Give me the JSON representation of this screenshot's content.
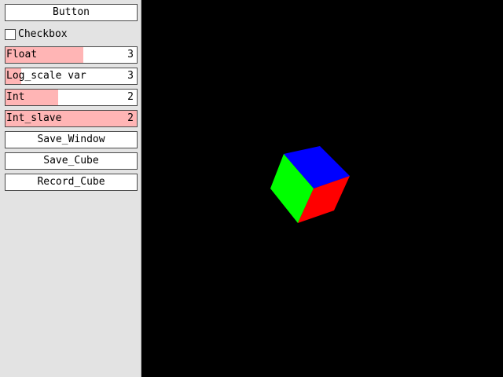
{
  "panel": {
    "button_label": "Button",
    "checkbox": {
      "label": "Checkbox",
      "checked": false
    },
    "sliders": [
      {
        "label": "Float",
        "value": "3",
        "fill_fraction": 0.59
      },
      {
        "label": "Log_scale var",
        "value": "3",
        "fill_fraction": 0.12
      },
      {
        "label": "Int",
        "value": "2",
        "fill_fraction": 0.4
      },
      {
        "label": "Int_slave",
        "value": "2",
        "fill_fraction": 1.0
      }
    ],
    "save_window_label": "Save_Window",
    "save_cube_label": "Save_Cube",
    "record_cube_label": "Record_Cube"
  },
  "colors": {
    "panel_bg": "#e3e3e3",
    "slider_fill": "#ffb5b5",
    "viewport_bg": "#000000",
    "cube_top": "#0000ff",
    "cube_left": "#00ff00",
    "cube_right": "#ff0000"
  }
}
